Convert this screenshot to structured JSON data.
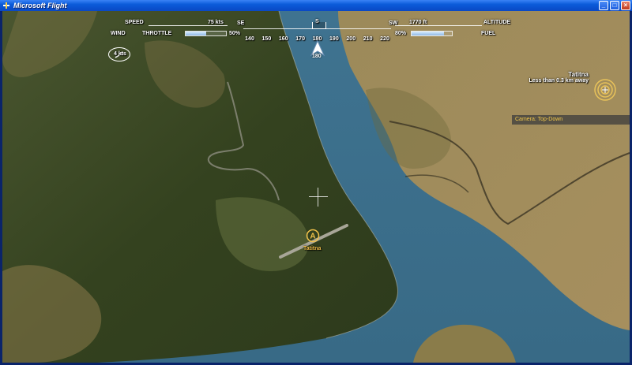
{
  "window": {
    "title": "Microsoft Flight",
    "minimize_glyph": "_",
    "maximize_glyph": "□",
    "close_glyph": "×",
    "title_bar_color": "#0b5bd9"
  },
  "hud": {
    "speed_label": "SPEED",
    "speed_value": "75 kts",
    "throttle_label": "THROTTLE",
    "throttle_value": "50%",
    "throttle_level": 0.5,
    "wind_label": "WIND",
    "wind_value": "4 kts",
    "altitude_label": "ALTITUDE",
    "altitude_value": "1770 ft",
    "fuel_label": "FUEL",
    "fuel_value": "80%",
    "fuel_level": 0.8,
    "compass": {
      "left_cardinal": "SE",
      "top_cardinal": "S",
      "right_cardinal": "SW",
      "ticks": [
        "140",
        "150",
        "160",
        "170",
        "180",
        "190",
        "200",
        "210",
        "220"
      ],
      "heading_value": "180"
    }
  },
  "poi": {
    "name": "Tatitna",
    "distance": "Less than 0.3 km away"
  },
  "camera": {
    "label": "Camera: Top-Down"
  },
  "airport": {
    "marker_letter": "A",
    "name": "Tatitna"
  },
  "colors": {
    "water": "#3d6f8a",
    "forest": "#3a4a25",
    "tundra": "#a08a58",
    "hud_text": "#ffffff",
    "accent_label": "#f0c14b"
  },
  "icons": [
    "app-icon",
    "wind-arrow-icon",
    "aircraft-icon",
    "target-icon",
    "airport-icon",
    "crosshair-icon"
  ]
}
